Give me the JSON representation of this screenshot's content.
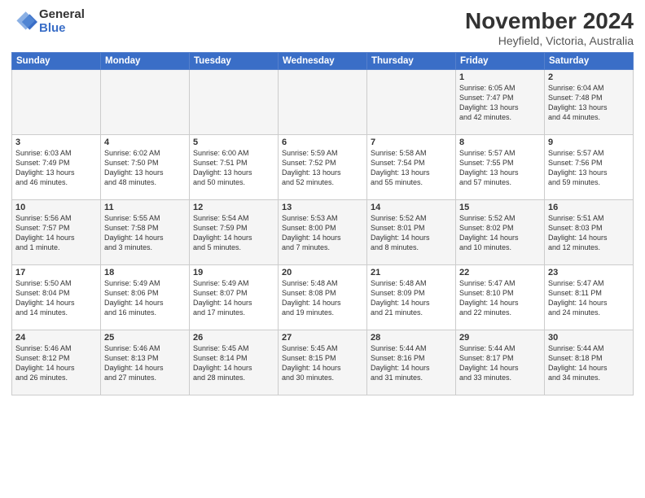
{
  "header": {
    "logo_general": "General",
    "logo_blue": "Blue",
    "main_title": "November 2024",
    "sub_title": "Heyfield, Victoria, Australia"
  },
  "weekdays": [
    "Sunday",
    "Monday",
    "Tuesday",
    "Wednesday",
    "Thursday",
    "Friday",
    "Saturday"
  ],
  "weeks": [
    [
      {
        "day": "",
        "info": ""
      },
      {
        "day": "",
        "info": ""
      },
      {
        "day": "",
        "info": ""
      },
      {
        "day": "",
        "info": ""
      },
      {
        "day": "",
        "info": ""
      },
      {
        "day": "1",
        "info": "Sunrise: 6:05 AM\nSunset: 7:47 PM\nDaylight: 13 hours\nand 42 minutes."
      },
      {
        "day": "2",
        "info": "Sunrise: 6:04 AM\nSunset: 7:48 PM\nDaylight: 13 hours\nand 44 minutes."
      }
    ],
    [
      {
        "day": "3",
        "info": "Sunrise: 6:03 AM\nSunset: 7:49 PM\nDaylight: 13 hours\nand 46 minutes."
      },
      {
        "day": "4",
        "info": "Sunrise: 6:02 AM\nSunset: 7:50 PM\nDaylight: 13 hours\nand 48 minutes."
      },
      {
        "day": "5",
        "info": "Sunrise: 6:00 AM\nSunset: 7:51 PM\nDaylight: 13 hours\nand 50 minutes."
      },
      {
        "day": "6",
        "info": "Sunrise: 5:59 AM\nSunset: 7:52 PM\nDaylight: 13 hours\nand 52 minutes."
      },
      {
        "day": "7",
        "info": "Sunrise: 5:58 AM\nSunset: 7:54 PM\nDaylight: 13 hours\nand 55 minutes."
      },
      {
        "day": "8",
        "info": "Sunrise: 5:57 AM\nSunset: 7:55 PM\nDaylight: 13 hours\nand 57 minutes."
      },
      {
        "day": "9",
        "info": "Sunrise: 5:57 AM\nSunset: 7:56 PM\nDaylight: 13 hours\nand 59 minutes."
      }
    ],
    [
      {
        "day": "10",
        "info": "Sunrise: 5:56 AM\nSunset: 7:57 PM\nDaylight: 14 hours\nand 1 minute."
      },
      {
        "day": "11",
        "info": "Sunrise: 5:55 AM\nSunset: 7:58 PM\nDaylight: 14 hours\nand 3 minutes."
      },
      {
        "day": "12",
        "info": "Sunrise: 5:54 AM\nSunset: 7:59 PM\nDaylight: 14 hours\nand 5 minutes."
      },
      {
        "day": "13",
        "info": "Sunrise: 5:53 AM\nSunset: 8:00 PM\nDaylight: 14 hours\nand 7 minutes."
      },
      {
        "day": "14",
        "info": "Sunrise: 5:52 AM\nSunset: 8:01 PM\nDaylight: 14 hours\nand 8 minutes."
      },
      {
        "day": "15",
        "info": "Sunrise: 5:52 AM\nSunset: 8:02 PM\nDaylight: 14 hours\nand 10 minutes."
      },
      {
        "day": "16",
        "info": "Sunrise: 5:51 AM\nSunset: 8:03 PM\nDaylight: 14 hours\nand 12 minutes."
      }
    ],
    [
      {
        "day": "17",
        "info": "Sunrise: 5:50 AM\nSunset: 8:04 PM\nDaylight: 14 hours\nand 14 minutes."
      },
      {
        "day": "18",
        "info": "Sunrise: 5:49 AM\nSunset: 8:06 PM\nDaylight: 14 hours\nand 16 minutes."
      },
      {
        "day": "19",
        "info": "Sunrise: 5:49 AM\nSunset: 8:07 PM\nDaylight: 14 hours\nand 17 minutes."
      },
      {
        "day": "20",
        "info": "Sunrise: 5:48 AM\nSunset: 8:08 PM\nDaylight: 14 hours\nand 19 minutes."
      },
      {
        "day": "21",
        "info": "Sunrise: 5:48 AM\nSunset: 8:09 PM\nDaylight: 14 hours\nand 21 minutes."
      },
      {
        "day": "22",
        "info": "Sunrise: 5:47 AM\nSunset: 8:10 PM\nDaylight: 14 hours\nand 22 minutes."
      },
      {
        "day": "23",
        "info": "Sunrise: 5:47 AM\nSunset: 8:11 PM\nDaylight: 14 hours\nand 24 minutes."
      }
    ],
    [
      {
        "day": "24",
        "info": "Sunrise: 5:46 AM\nSunset: 8:12 PM\nDaylight: 14 hours\nand 26 minutes."
      },
      {
        "day": "25",
        "info": "Sunrise: 5:46 AM\nSunset: 8:13 PM\nDaylight: 14 hours\nand 27 minutes."
      },
      {
        "day": "26",
        "info": "Sunrise: 5:45 AM\nSunset: 8:14 PM\nDaylight: 14 hours\nand 28 minutes."
      },
      {
        "day": "27",
        "info": "Sunrise: 5:45 AM\nSunset: 8:15 PM\nDaylight: 14 hours\nand 30 minutes."
      },
      {
        "day": "28",
        "info": "Sunrise: 5:44 AM\nSunset: 8:16 PM\nDaylight: 14 hours\nand 31 minutes."
      },
      {
        "day": "29",
        "info": "Sunrise: 5:44 AM\nSunset: 8:17 PM\nDaylight: 14 hours\nand 33 minutes."
      },
      {
        "day": "30",
        "info": "Sunrise: 5:44 AM\nSunset: 8:18 PM\nDaylight: 14 hours\nand 34 minutes."
      }
    ]
  ]
}
